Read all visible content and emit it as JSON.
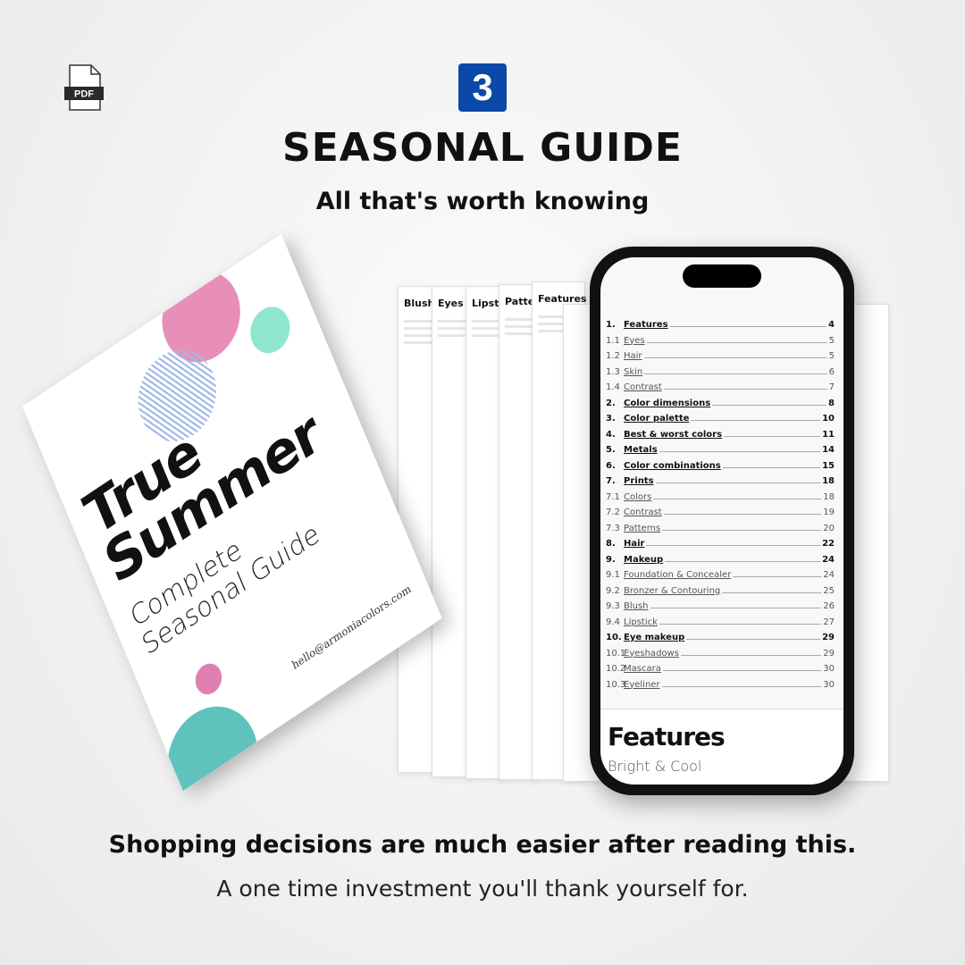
{
  "header": {
    "file_type": "PDF",
    "step_number": "3",
    "title": "SEASONAL GUIDE",
    "subtitle": "All that's worth knowing"
  },
  "book": {
    "title_line1": "True",
    "title_line2": "Summer",
    "subtitle_line1": "Complete",
    "subtitle_line2": "Seasonal Guide",
    "email": "hello@armoniacolors.com",
    "colors": {
      "pink": "#e78fb8",
      "blue": "#9fb8e8",
      "mint": "#8fe6cf",
      "teal": "#5fc2bd",
      "spine": "#7fd8b9"
    }
  },
  "pages": [
    "Blush",
    "Eyes",
    "Lipstick",
    "Patterns",
    "Features"
  ],
  "phone": {
    "toc": [
      {
        "num": "1.",
        "label": "Features",
        "page": "4",
        "main": true
      },
      {
        "num": "1.1",
        "label": "Eyes",
        "page": "5"
      },
      {
        "num": "1.2",
        "label": "Hair",
        "page": "5"
      },
      {
        "num": "1.3",
        "label": "Skin",
        "page": "6"
      },
      {
        "num": "1.4",
        "label": "Contrast",
        "page": "7"
      },
      {
        "num": "2.",
        "label": "Color dimensions",
        "page": "8",
        "main": true
      },
      {
        "num": "3.",
        "label": "Color palette",
        "page": "10",
        "main": true
      },
      {
        "num": "4.",
        "label": "Best & worst colors",
        "page": "11",
        "main": true
      },
      {
        "num": "5.",
        "label": "Metals",
        "page": "14",
        "main": true
      },
      {
        "num": "6.",
        "label": "Color combinations",
        "page": "15",
        "main": true
      },
      {
        "num": "7.",
        "label": "Prints",
        "page": "18",
        "main": true
      },
      {
        "num": "7.1",
        "label": "Colors",
        "page": "18"
      },
      {
        "num": "7.2",
        "label": "Contrast",
        "page": "19"
      },
      {
        "num": "7.3",
        "label": "Patterns",
        "page": "20"
      },
      {
        "num": "8.",
        "label": "Hair",
        "page": "22",
        "main": true
      },
      {
        "num": "9.",
        "label": "Makeup",
        "page": "24",
        "main": true
      },
      {
        "num": "9.1",
        "label": "Foundation & Concealer",
        "page": "24"
      },
      {
        "num": "9.2",
        "label": "Bronzer & Contouring",
        "page": "25"
      },
      {
        "num": "9.3",
        "label": "Blush",
        "page": "26"
      },
      {
        "num": "9.4",
        "label": "Lipstick",
        "page": "27"
      },
      {
        "num": "10.",
        "label": "Eye makeup",
        "page": "29",
        "main": true
      },
      {
        "num": "10.1",
        "label": "Eyeshadows",
        "page": "29"
      },
      {
        "num": "10.2",
        "label": "Mascara",
        "page": "30"
      },
      {
        "num": "10.3",
        "label": "Eyeliner",
        "page": "30"
      }
    ],
    "section_title": "Features",
    "section_subtitle": "Bright & Cool"
  },
  "footer": {
    "headline": "Shopping decisions are much easier after reading this.",
    "tagline": "A one time investment you'll thank yourself for."
  },
  "colors": {
    "badge": "#0b49a8"
  }
}
